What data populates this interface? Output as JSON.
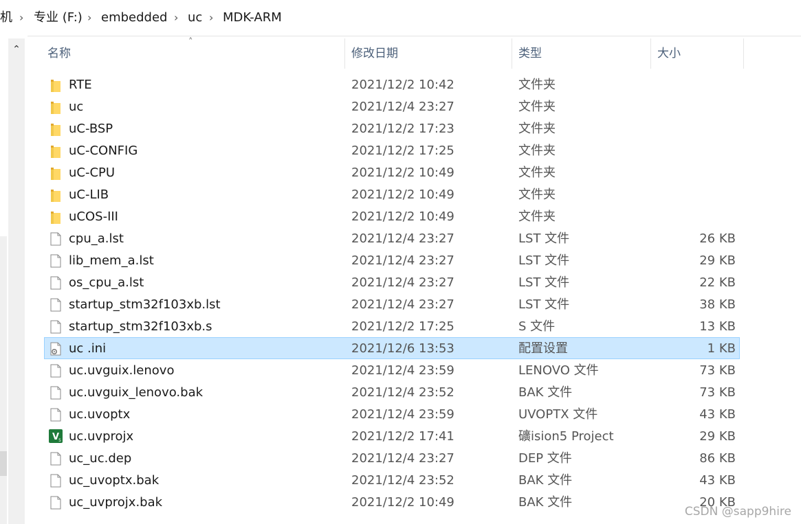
{
  "breadcrumb": [
    {
      "label": "机"
    },
    {
      "label": "专业 (F:)"
    },
    {
      "label": "embedded"
    },
    {
      "label": "uc"
    },
    {
      "label": "MDK-ARM"
    }
  ],
  "breadcrumb_separator": "›",
  "scroll_up_glyph": "⌃",
  "columns": {
    "name": "名称",
    "date": "修改日期",
    "type": "类型",
    "size": "大小"
  },
  "sort_glyph": "˄",
  "colors": {
    "folder": "#f2c94c",
    "selected_bg": "#cce8ff",
    "selected_border": "#99d1ff",
    "header_text": "#4c607a"
  },
  "files": [
    {
      "name": "RTE",
      "date": "2021/12/2 10:42",
      "type": "文件夹",
      "size": "",
      "icon": "folder-icon"
    },
    {
      "name": "uc",
      "date": "2021/12/4 23:27",
      "type": "文件夹",
      "size": "",
      "icon": "folder-icon"
    },
    {
      "name": "uC-BSP",
      "date": "2021/12/2 17:23",
      "type": "文件夹",
      "size": "",
      "icon": "folder-icon"
    },
    {
      "name": "uC-CONFIG",
      "date": "2021/12/2 17:25",
      "type": "文件夹",
      "size": "",
      "icon": "folder-icon"
    },
    {
      "name": "uC-CPU",
      "date": "2021/12/2 10:49",
      "type": "文件夹",
      "size": "",
      "icon": "folder-icon"
    },
    {
      "name": "uC-LIB",
      "date": "2021/12/2 10:49",
      "type": "文件夹",
      "size": "",
      "icon": "folder-icon"
    },
    {
      "name": "uCOS-III",
      "date": "2021/12/2 10:49",
      "type": "文件夹",
      "size": "",
      "icon": "folder-icon"
    },
    {
      "name": "cpu_a.lst",
      "date": "2021/12/4 23:27",
      "type": "LST 文件",
      "size": "26 KB",
      "icon": "file-icon"
    },
    {
      "name": "lib_mem_a.lst",
      "date": "2021/12/4 23:27",
      "type": "LST 文件",
      "size": "29 KB",
      "icon": "file-icon"
    },
    {
      "name": "os_cpu_a.lst",
      "date": "2021/12/4 23:27",
      "type": "LST 文件",
      "size": "22 KB",
      "icon": "file-icon"
    },
    {
      "name": "startup_stm32f103xb.lst",
      "date": "2021/12/4 23:27",
      "type": "LST 文件",
      "size": "38 KB",
      "icon": "file-icon"
    },
    {
      "name": "startup_stm32f103xb.s",
      "date": "2021/12/2 17:25",
      "type": "S 文件",
      "size": "13 KB",
      "icon": "file-icon"
    },
    {
      "name": "uc .ini",
      "date": "2021/12/6 13:53",
      "type": "配置设置",
      "size": "1 KB",
      "icon": "settings-file-icon",
      "selected": true
    },
    {
      "name": "uc.uvguix.lenovo",
      "date": "2021/12/4 23:59",
      "type": "LENOVO 文件",
      "size": "73 KB",
      "icon": "file-icon"
    },
    {
      "name": "uc.uvguix_lenovo.bak",
      "date": "2021/12/4 23:52",
      "type": "BAK 文件",
      "size": "73 KB",
      "icon": "file-icon"
    },
    {
      "name": "uc.uvoptx",
      "date": "2021/12/4 23:59",
      "type": "UVOPTX 文件",
      "size": "43 KB",
      "icon": "file-icon"
    },
    {
      "name": "uc.uvprojx",
      "date": "2021/12/2 17:41",
      "type": "礦ision5 Project",
      "size": "29 KB",
      "icon": "keil-project-icon"
    },
    {
      "name": "uc_uc.dep",
      "date": "2021/12/4 23:27",
      "type": "DEP 文件",
      "size": "86 KB",
      "icon": "file-icon"
    },
    {
      "name": "uc_uvoptx.bak",
      "date": "2021/12/4 23:52",
      "type": "BAK 文件",
      "size": "43 KB",
      "icon": "file-icon"
    },
    {
      "name": "uc_uvprojx.bak",
      "date": "2021/12/2 10:49",
      "type": "BAK 文件",
      "size": "20 KB",
      "icon": "file-icon"
    }
  ],
  "watermark": "CSDN @sapp9hire"
}
